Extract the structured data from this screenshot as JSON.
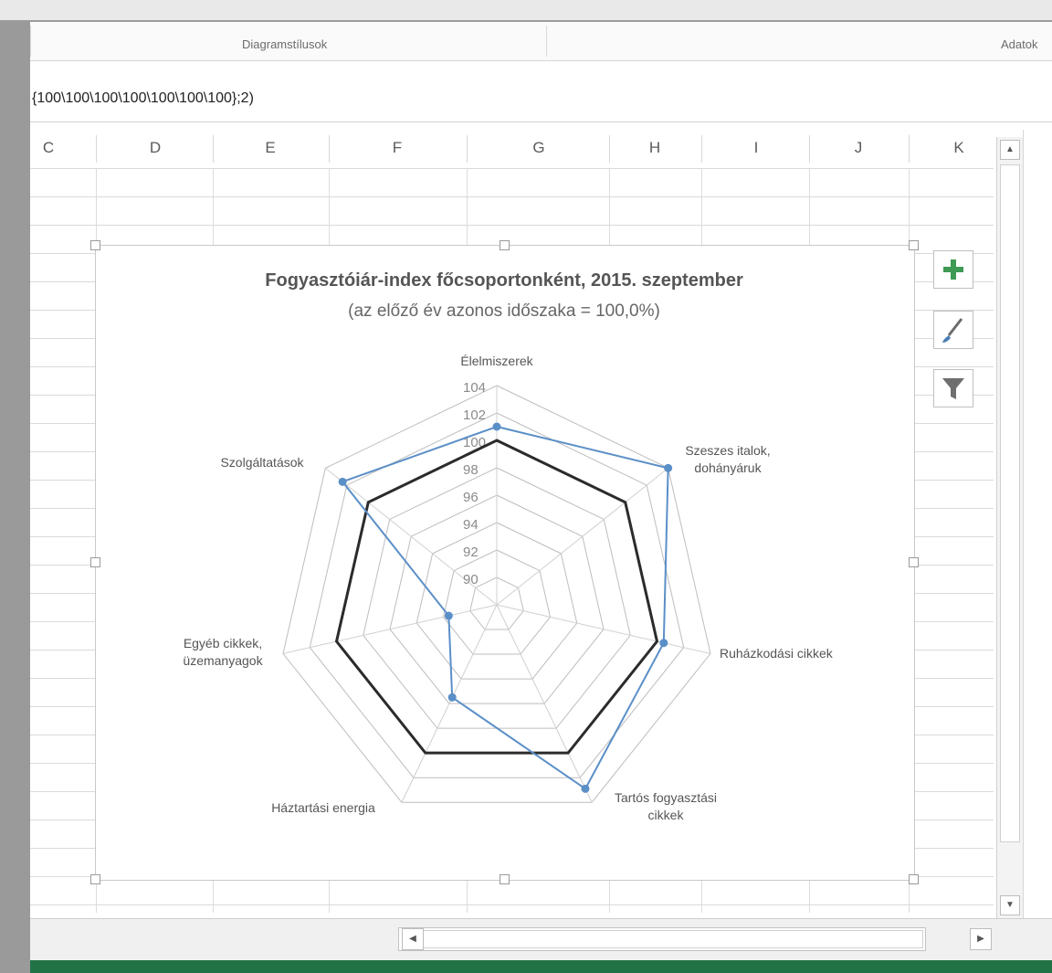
{
  "ribbon": {
    "group_chart_styles": "Diagramstílusok",
    "group_data": "Adatok"
  },
  "formula_bar": {
    "text": "{100\\100\\100\\100\\100\\100\\100};2)"
  },
  "column_headers": [
    "C",
    "D",
    "E",
    "F",
    "G",
    "H",
    "I",
    "J",
    "K"
  ],
  "chart_buttons": [
    {
      "name": "add-chart-element",
      "icon": "plus-icon"
    },
    {
      "name": "chart-styles",
      "icon": "brush-icon"
    },
    {
      "name": "chart-filters",
      "icon": "filter-icon"
    }
  ],
  "chart_data": {
    "type": "radar",
    "title": "Fogyasztóiár-index főcsoportonként, 2015. szeptember",
    "subtitle": "(az előző év azonos időszaka = 100,0%)",
    "categories": [
      [
        "Élelmiszerek"
      ],
      [
        "Szeszes italok,",
        "dohányáruk"
      ],
      [
        "Ruházkodási cikkek"
      ],
      [
        "Tartós fogyasztási",
        "cikkek"
      ],
      [
        "Háztartási energia"
      ],
      [
        "Egyéb cikkek,",
        "üzemanyagok"
      ],
      [
        "Szolgáltatások"
      ]
    ],
    "axis_min": 88,
    "axis_max": 104,
    "axis_step": 2,
    "tick_labels": [
      "90",
      "92",
      "94",
      "96",
      "98",
      "100",
      "102",
      "104"
    ],
    "grid": true,
    "series": [
      {
        "values": [
          100,
          100,
          100,
          100,
          100,
          100,
          100
        ],
        "color": "#2b2b2b"
      },
      {
        "values": [
          101.0,
          104.0,
          100.5,
          102.9,
          95.5,
          91.6,
          102.4
        ],
        "color": "#5b8fc7"
      }
    ]
  }
}
